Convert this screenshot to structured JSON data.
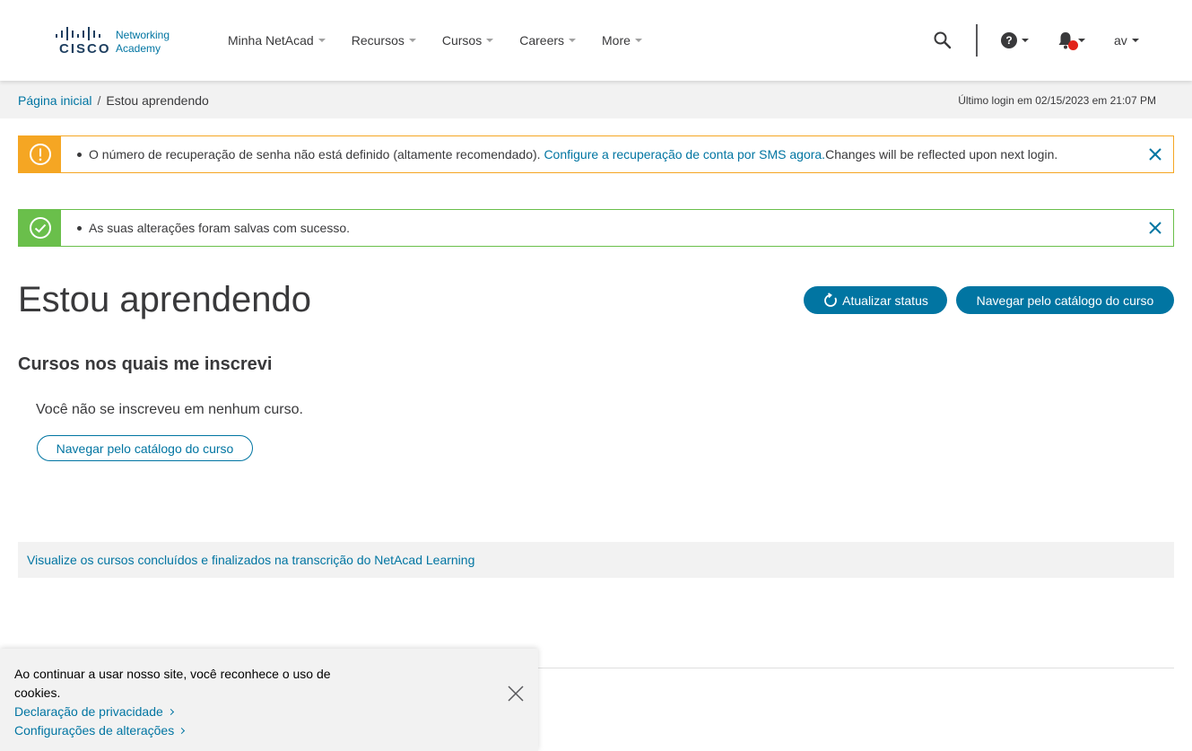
{
  "brand": {
    "wordmark": "CISCO",
    "product_line1": "Networking",
    "product_line2": "Academy"
  },
  "nav": [
    {
      "label": "Minha NetAcad"
    },
    {
      "label": "Recursos"
    },
    {
      "label": "Cursos"
    },
    {
      "label": "Careers"
    },
    {
      "label": "More"
    }
  ],
  "header": {
    "user_initials": "av",
    "icons": [
      "search-icon",
      "help-icon",
      "bell-icon"
    ],
    "notification_color": "#e2231a"
  },
  "breadcrumb": {
    "home": "Página inicial",
    "separator": "/",
    "current": "Estou aprendendo"
  },
  "last_login": "Último login em 02/15/2023 em 21:07 PM",
  "alerts": {
    "warning": {
      "color": "#f5a623",
      "text": "O número de recuperação de senha não está definido (altamente recomendado).",
      "link": "Configure a recuperação de conta por SMS agora.",
      "suffix": "Changes will be reflected upon next login."
    },
    "success": {
      "color": "#6abf4b",
      "text": "As suas alterações foram salvas com sucesso."
    }
  },
  "main": {
    "title": "Estou aprendendo",
    "refresh_button": "Atualizar status",
    "catalog_button": "Navegar pelo catálogo do curso",
    "section_title": "Cursos nos quais me inscrevi",
    "empty_message": "Você não se inscreveu em nenhum curso.",
    "empty_catalog_button": "Navegar pelo catálogo do curso",
    "transcript_link": "Visualize os cursos concluídos e finalizados na transcrição do NetAcad Learning"
  },
  "cookie": {
    "text": "Ao continuar a usar nosso site, você reconhece o uso de cookies.",
    "privacy_link": "Declaração de privacidade",
    "settings_link": "Configurações de alterações"
  },
  "colors": {
    "accent": "#0175a2",
    "text": "#39393b",
    "subbar": "#f2f2f2"
  }
}
